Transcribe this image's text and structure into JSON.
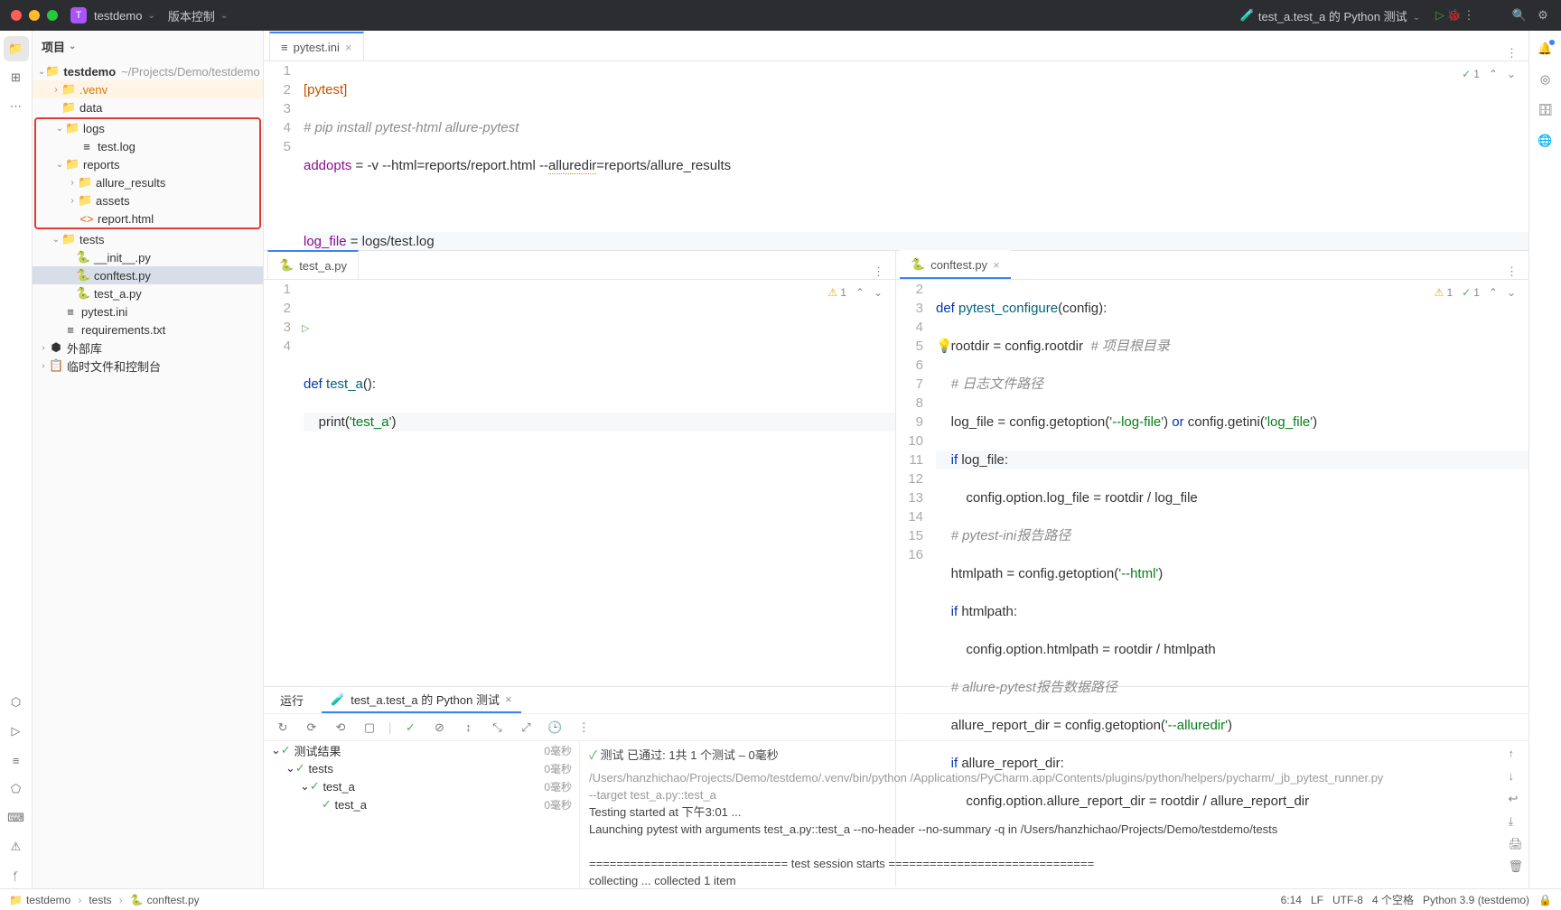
{
  "titlebar": {
    "project_badge": "T",
    "project_name": "testdemo",
    "vcs": "版本控制",
    "run_config": "test_a.test_a 的 Python 测试"
  },
  "sidebar": {
    "header": "项目",
    "root": "testdemo",
    "root_path": "~/Projects/Demo/testdemo",
    "items": {
      "venv": ".venv",
      "data": "data",
      "logs": "logs",
      "test_log": "test.log",
      "reports": "reports",
      "allure": "allure_results",
      "assets": "assets",
      "report_html": "report.html",
      "tests": "tests",
      "init": "__init__.py",
      "conftest": "conftest.py",
      "test_a": "test_a.py",
      "pytest_ini": "pytest.ini",
      "requirements": "requirements.txt",
      "ext_lib": "外部库",
      "scratch": "临时文件和控制台"
    }
  },
  "top_tab": {
    "label": "pytest.ini"
  },
  "pytest_ini_code": {
    "l1": "[pytest]",
    "l2": "# pip install pytest-html allure-pytest",
    "l3a": "addopts",
    "l3b": " = -v --html=reports/report.html --",
    "l3c": "alluredir",
    "l3d": "=reports/allure_results",
    "l5a": "log_file",
    "l5b": " = logs/test.log"
  },
  "pytest_ini_badge": "1",
  "sub_left": {
    "tab": "test_a.py",
    "badge": "1"
  },
  "test_a_code": {
    "l3a": "def ",
    "l3b": "test_a",
    "l3c": "():",
    "l4a": "    print(",
    "l4b": "'test_a'",
    "l4c": ")"
  },
  "sub_right": {
    "tab": "conftest.py",
    "warn": "1",
    "ok": "1"
  },
  "conftest_code": {
    "l2": "def pytest_configure(config):",
    "l3a": "    rootdir = config.rootdir  ",
    "l3b": "# 项目根目录",
    "l4": "    # 日志文件路径",
    "l5a": "    log_file = config.getoption(",
    "l5b": "'--log-file'",
    "l5c": ") ",
    "l5d": "or",
    "l5e": " config.getini(",
    "l5f": "'log_file'",
    "l5g": ")",
    "l6a": "    if ",
    "l6b": "log_file:",
    "l7": "        config.option.log_file = rootdir / log_file",
    "l8": "    # pytest-ini报告路径",
    "l9a": "    htmlpath = config.getoption(",
    "l9b": "'--html'",
    "l9c": ")",
    "l10a": "    if ",
    "l10b": "htmlpath:",
    "l11": "        config.option.htmlpath = rootdir / htmlpath",
    "l12": "    # allure-pytest报告数据路径",
    "l13a": "    allure_report_dir = config.getoption(",
    "l13b": "'--alluredir'",
    "l13c": ")",
    "l14a": "    if ",
    "l14b": "allure_report_dir:",
    "l15": "        config.option.allure_report_dir = rootdir / allure_report_dir"
  },
  "bottom": {
    "run_tab": "运行",
    "test_tab": "test_a.test_a 的 Python 测试",
    "tree": {
      "root": "测试结果",
      "root_time": "0毫秒",
      "tests": "tests",
      "tests_time": "0毫秒",
      "test_a_mod": "test_a",
      "test_a_mod_time": "0毫秒",
      "test_a_fn": "test_a",
      "test_a_fn_time": "0毫秒"
    },
    "summary": "测试 已通过: 1共 1 个测试 – 0毫秒",
    "console": {
      "l1": "/Users/hanzhichao/Projects/Demo/testdemo/.venv/bin/python /Applications/PyCharm.app/Contents/plugins/python/helpers/pycharm/_jb_pytest_runner.py ",
      "l2": " --target test_a.py::test_a",
      "l3": "Testing started at 下午3:01 ...",
      "l4": "Launching pytest with arguments test_a.py::test_a --no-header --no-summary -q in /Users/hanzhichao/Projects/Demo/testdemo/tests",
      "l5": "============================= test session starts ==============================",
      "l6": "collecting ... collected 1 item"
    }
  },
  "status": {
    "crumb1": "testdemo",
    "crumb2": "tests",
    "crumb3": "conftest.py",
    "pos": "6:14",
    "eol": "LF",
    "enc": "UTF-8",
    "indent": "4 个空格",
    "py": "Python 3.9 (testdemo)"
  }
}
